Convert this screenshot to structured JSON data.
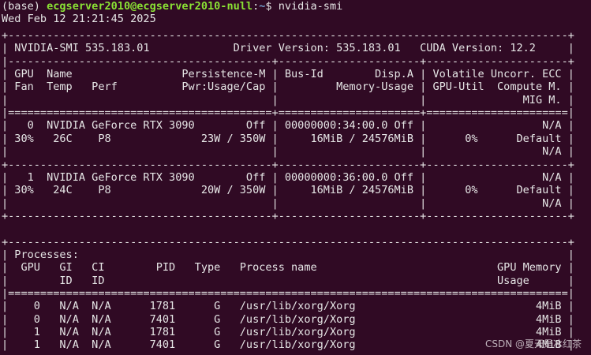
{
  "prompt": {
    "env": "(base) ",
    "user_host": "ecgserver2010@ecgserver2010-null",
    "separator": ":",
    "cwd": "~",
    "symbol": "$ ",
    "command": "nvidia-smi"
  },
  "timestamp": "Wed Feb 12 21:21:45 2025",
  "output_lines": [
    "+---------------------------------------------------------------------------------------+",
    "| NVIDIA-SMI 535.183.01             Driver Version: 535.183.01   CUDA Version: 12.2     |",
    "|-----------------------------------------+----------------------+----------------------+",
    "| GPU  Name                 Persistence-M | Bus-Id        Disp.A | Volatile Uncorr. ECC |",
    "| Fan  Temp   Perf          Pwr:Usage/Cap |         Memory-Usage | GPU-Util  Compute M. |",
    "|                                         |                      |               MIG M. |",
    "|=========================================+======================+======================|",
    "|   0  NVIDIA GeForce RTX 3090        Off | 00000000:34:00.0 Off |                  N/A |",
    "| 30%   26C    P8              23W / 350W |     16MiB / 24576MiB |      0%      Default |",
    "|                                         |                      |                  N/A |",
    "+-----------------------------------------+----------------------+----------------------+",
    "|   1  NVIDIA GeForce RTX 3090        Off | 00000000:36:00.0 Off |                  N/A |",
    "| 30%   24C    P8              20W / 350W |     16MiB / 24576MiB |      0%      Default |",
    "|                                         |                      |                  N/A |",
    "+-----------------------------------------+----------------------+----------------------+",
    "",
    "+---------------------------------------------------------------------------------------+",
    "| Processes:                                                                            |",
    "|  GPU   GI   CI        PID   Type   Process name                            GPU Memory |",
    "|        ID   ID                                                             Usage      |",
    "|=======================================================================================|",
    "|    0   N/A  N/A      1781      G   /usr/lib/xorg/Xorg                            4MiB |",
    "|    0   N/A  N/A      7401      G   /usr/lib/xorg/Xorg                            4MiB |",
    "|    1   N/A  N/A      1781      G   /usr/lib/xorg/Xorg                            4MiB |",
    "|    1   N/A  N/A      7401      G   /usr/lib/xorg/Xorg                            4MiB |",
    "+---------------------------------------------------------------------------------------+"
  ],
  "watermark": "CSDN @夏天是冰红茶",
  "colors": {
    "background": "#300a24",
    "text": "#e6e6e6",
    "user_host": "#8ae234",
    "path": "#729fcf"
  }
}
